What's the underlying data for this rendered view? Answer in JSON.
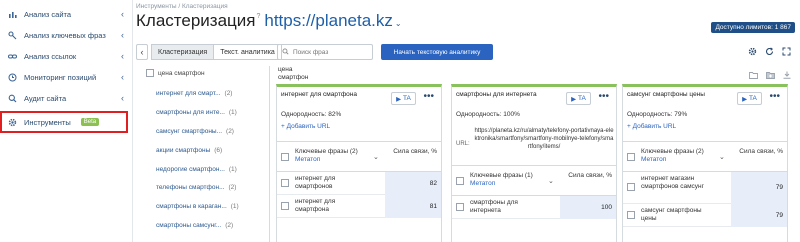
{
  "sidebar": {
    "items": [
      {
        "label": "Анализ сайта"
      },
      {
        "label": "Анализ ключевых фраз"
      },
      {
        "label": "Анализ ссылок"
      },
      {
        "label": "Мониторинг позиций"
      },
      {
        "label": "Аудит сайта"
      },
      {
        "label": "Инструменты",
        "badge": "Beta"
      }
    ]
  },
  "header": {
    "breadcrumb": "Инструменты / Кластеризация",
    "title": "Кластеризация",
    "help_mark": "?",
    "site": "https://planeta.kz",
    "limits": "Доступно лимитов: 1 867"
  },
  "toolbar": {
    "tabs": [
      "Кластеризация",
      "Текст. аналитика"
    ],
    "search_placeholder": "Поиск фраз",
    "primary_button": "Начать текстовую аналитику"
  },
  "phrases": {
    "root": "цена смартфон",
    "items": [
      {
        "label": "интернет для смарт...",
        "count": "(2)"
      },
      {
        "label": "смартфоны для инте...",
        "count": "(1)"
      },
      {
        "label": "самсунг смартфоны...",
        "count": "(2)"
      },
      {
        "label": "акции смартфоны",
        "count": "(6)"
      },
      {
        "label": "недорогие смартфон...",
        "count": "(1)"
      },
      {
        "label": "телефоны смартфон...",
        "count": "(2)"
      },
      {
        "label": "смартфоны в караган...",
        "count": "(1)"
      },
      {
        "label": "смартфоны самсунг...",
        "count": "(2)"
      }
    ]
  },
  "cluster_area": {
    "root_label_1": "цена",
    "root_label_2": "смартфон"
  },
  "clusters": [
    {
      "title": "интернет для смартфона",
      "ta": "TA",
      "homogeneity": "Однородность: 82%",
      "add_url": "+ Добавить URL",
      "url_label": "",
      "url": "",
      "col_phrases": "Ключевые фразы",
      "col_count": "(2)",
      "col_meta": "Метатоп",
      "col_link": "Сила связи, %",
      "rows": [
        {
          "kw": "интернет для смартфонов",
          "val": "82"
        },
        {
          "kw": "интернет для смартфона",
          "val": "81"
        }
      ]
    },
    {
      "title": "смартфоны для интернета",
      "ta": "TA",
      "homogeneity": "Однородность: 100%",
      "add_url": "",
      "url_label": "URL:",
      "url": "https://planeta.kz/ru/almaty/telefony-portativnaya-elektronika/smartfony/smartfony-mobilnye-telefony/smartfony/items/",
      "col_phrases": "Ключевые фразы",
      "col_count": "(1)",
      "col_meta": "Метатоп",
      "col_link": "Сила связи, %",
      "rows": [
        {
          "kw": "смартфоны для интернета",
          "val": "100"
        }
      ]
    },
    {
      "title": "самсунг смартфоны цены",
      "ta": "TA",
      "homogeneity": "Однородность: 79%",
      "add_url": "+ Добавить URL",
      "url_label": "",
      "url": "",
      "col_phrases": "Ключевые фразы",
      "col_count": "(2)",
      "col_meta": "Метатоп",
      "col_link": "Сила связи, %",
      "rows": [
        {
          "kw": "интернет магазин смартфонов самсунг",
          "val": "79"
        },
        {
          "kw": "самсунг смартфоны цены",
          "val": "79"
        }
      ]
    }
  ],
  "icons": {
    "ta": "play-icon",
    "settings": "gear-icon",
    "refresh": "refresh-icon",
    "expand": "expand-icon"
  }
}
